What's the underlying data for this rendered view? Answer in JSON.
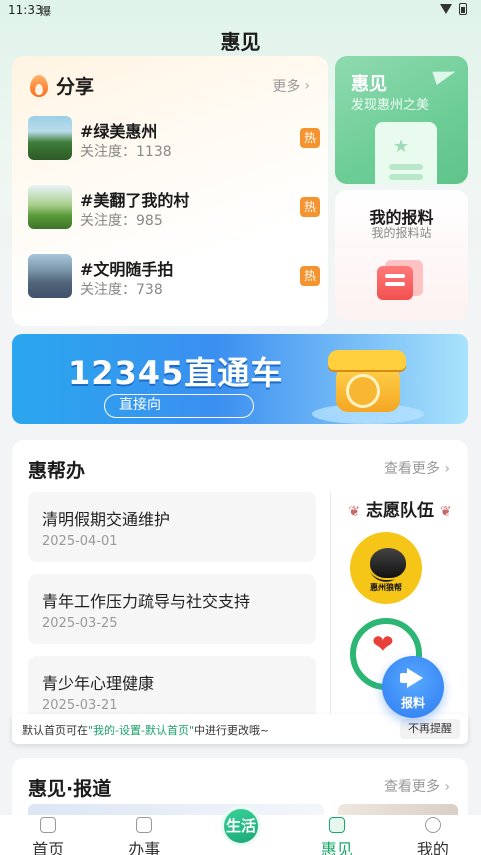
{
  "status_bar": {
    "time": "11:33",
    "notification": "爆"
  },
  "app": {
    "title": "惠见"
  },
  "share": {
    "title": "分享",
    "more": "更多",
    "topics": [
      {
        "name": "#绿美惠州",
        "meta": "关注度：1138",
        "badge": "热"
      },
      {
        "name": "#美翻了我的村",
        "meta": "关注度：985",
        "badge": "热"
      },
      {
        "name": "#文明随手拍",
        "meta": "关注度：738",
        "badge": "热"
      }
    ]
  },
  "huijian_card": {
    "title": "惠见",
    "subtitle": "发现惠州之美"
  },
  "report_card": {
    "title": "我的报料",
    "subtitle": "我的报料站"
  },
  "banner": {
    "title": "12345直通车",
    "button": "直接向"
  },
  "huibangban": {
    "title": "惠帮办",
    "more": "查看更多",
    "tasks": [
      {
        "name": "清明假期交通维护",
        "date": "2025-04-01"
      },
      {
        "name": "青年工作压力疏导与社交支持",
        "date": "2025-03-25"
      },
      {
        "name": "青少年心理健康",
        "date": "2025-03-21"
      }
    ],
    "volunteer_title": "志愿队伍"
  },
  "float_button": {
    "label": "报料"
  },
  "toast": {
    "prefix": "默认首页可在",
    "highlight": "\"我的-设置-默认首页\"",
    "suffix": "中进行更改哦~",
    "button": "不再提醒"
  },
  "reports": {
    "title": "惠见·报道",
    "more": "查看更多"
  },
  "bottom_nav": {
    "items": [
      {
        "label": "首页"
      },
      {
        "label": "办事"
      },
      {
        "label": "惠见"
      },
      {
        "label": "我的"
      }
    ],
    "center": "生活",
    "active_index": 2
  },
  "colors": {
    "accent": "#19a86a",
    "hot": "#f5932e"
  }
}
